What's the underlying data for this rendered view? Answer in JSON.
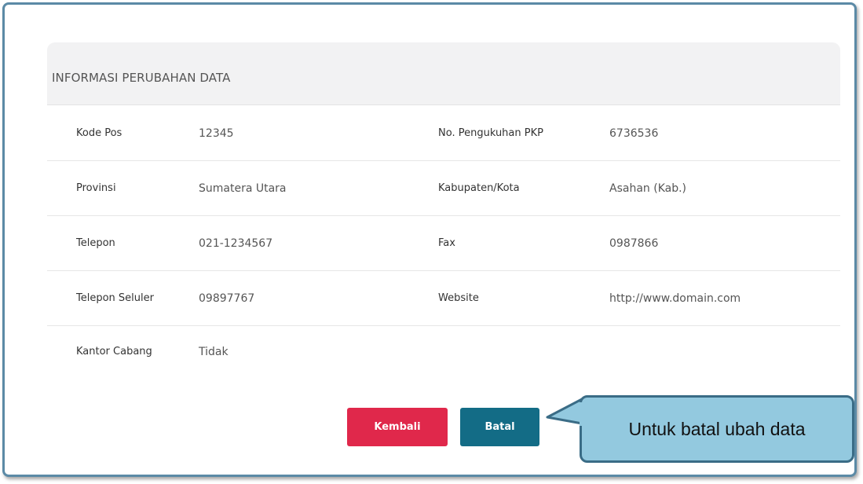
{
  "panel": {
    "title": "INFORMASI PERUBAHAN DATA"
  },
  "rows": [
    {
      "label1": "Kode Pos",
      "value1": "12345",
      "label2": "No. Pengukuhan PKP",
      "value2": "6736536"
    },
    {
      "label1": "Provinsi",
      "value1": "Sumatera Utara",
      "label2": "Kabupaten/Kota",
      "value2": "Asahan (Kab.)"
    },
    {
      "label1": "Telepon",
      "value1": "021-1234567",
      "label2": "Fax",
      "value2": "0987866"
    },
    {
      "label1": "Telepon Seluler",
      "value1": "09897767",
      "label2": "Website",
      "value2": "http://www.domain.com"
    },
    {
      "label1": "Kantor Cabang",
      "value1": "Tidak"
    }
  ],
  "buttons": {
    "back_label": "Kembali",
    "cancel_label": "Batal"
  },
  "callout": {
    "text": "Untuk batal ubah data"
  },
  "colors": {
    "back_button": "#e0284b",
    "cancel_button": "#136c86",
    "callout_fill": "#93c9df",
    "callout_border": "#3a6c86",
    "frame_border": "#5b8aa6"
  }
}
